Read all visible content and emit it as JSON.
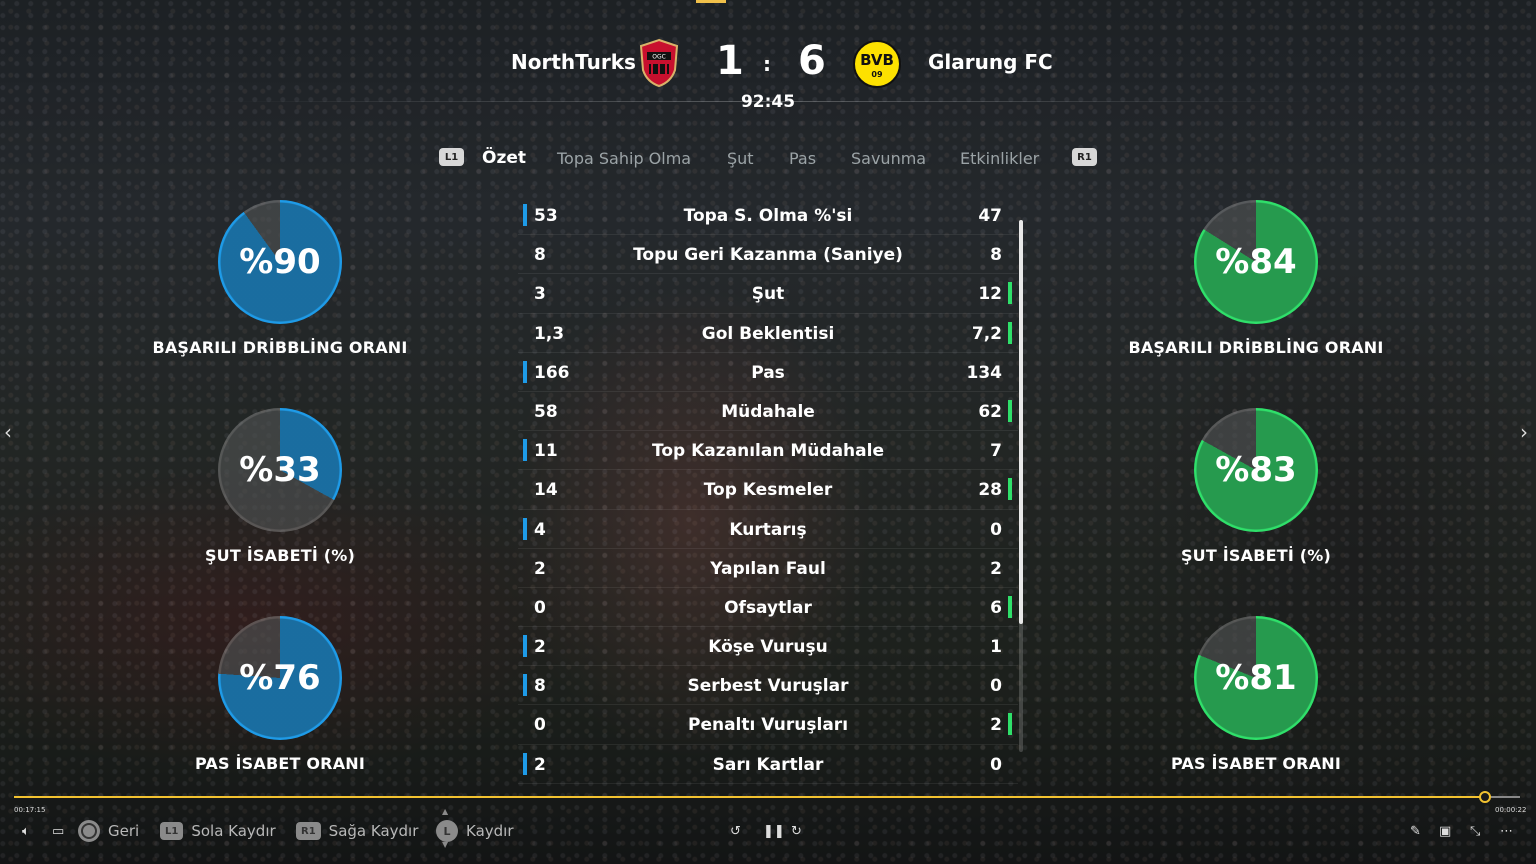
{
  "match": {
    "home_team": "NorthTurks",
    "away_team": "Glarung FC",
    "home_score": "1",
    "separator": ":",
    "away_score": "6",
    "clock": "92:45",
    "home_crest": "OGC NICE",
    "away_crest": "BVB 09"
  },
  "tabs": {
    "left_button": "L1",
    "right_button": "R1",
    "items": [
      "Özet",
      "Topa Sahip Olma",
      "Şut",
      "Pas",
      "Savunma",
      "Etkinlikler"
    ],
    "active": "Özet"
  },
  "stats": [
    {
      "name": "Topa S. Olma %'si",
      "home": "53",
      "away": "47",
      "leader": "home"
    },
    {
      "name": "Topu Geri Kazanma (Saniye)",
      "home": "8",
      "away": "8",
      "leader": "none"
    },
    {
      "name": "Şut",
      "home": "3",
      "away": "12",
      "leader": "away"
    },
    {
      "name": "Gol Beklentisi",
      "home": "1,3",
      "away": "7,2",
      "leader": "away"
    },
    {
      "name": "Pas",
      "home": "166",
      "away": "134",
      "leader": "home"
    },
    {
      "name": "Müdahale",
      "home": "58",
      "away": "62",
      "leader": "away"
    },
    {
      "name": "Top Kazanılan Müdahale",
      "home": "11",
      "away": "7",
      "leader": "home"
    },
    {
      "name": "Top Kesmeler",
      "home": "14",
      "away": "28",
      "leader": "away"
    },
    {
      "name": "Kurtarış",
      "home": "4",
      "away": "0",
      "leader": "home"
    },
    {
      "name": "Yapılan Faul",
      "home": "2",
      "away": "2",
      "leader": "none"
    },
    {
      "name": "Ofsaytlar",
      "home": "0",
      "away": "6",
      "leader": "away"
    },
    {
      "name": "Köşe Vuruşu",
      "home": "2",
      "away": "1",
      "leader": "home"
    },
    {
      "name": "Serbest Vuruşlar",
      "home": "8",
      "away": "0",
      "leader": "home"
    },
    {
      "name": "Penaltı Vuruşları",
      "home": "0",
      "away": "2",
      "leader": "away"
    },
    {
      "name": "Sarı Kartlar",
      "home": "2",
      "away": "0",
      "leader": "home"
    }
  ],
  "home_rings": [
    {
      "value": "%90",
      "label": "BAŞARILI DRİBBLİNG ORANI",
      "pct": 90
    },
    {
      "value": "%33",
      "label": "ŞUT İSABETİ (%)",
      "pct": 33
    },
    {
      "value": "%76",
      "label": "PAS İSABET ORANI",
      "pct": 76
    }
  ],
  "away_rings": [
    {
      "value": "%84",
      "label": "BAŞARILI DRİBBLİNG ORANI",
      "pct": 84
    },
    {
      "value": "%83",
      "label": "ŞUT İSABETİ (%)",
      "pct": 83
    },
    {
      "value": "%81",
      "label": "PAS İSABET ORANI",
      "pct": 81
    }
  ],
  "colors": {
    "home_accent": "#1e9be8",
    "away_accent": "#2fe06a",
    "timeline": "#f2c230"
  },
  "player": {
    "time_elapsed": "00:17:15",
    "time_remaining": "00:00:22",
    "progress_fraction": 0.977,
    "controls": {
      "back": "Geri",
      "scroll_left": "Sola Kaydır",
      "scroll_right": "Sağa Kaydır",
      "scroll": "Kaydır",
      "l1": "L1",
      "r1": "R1",
      "stick": "L"
    }
  }
}
